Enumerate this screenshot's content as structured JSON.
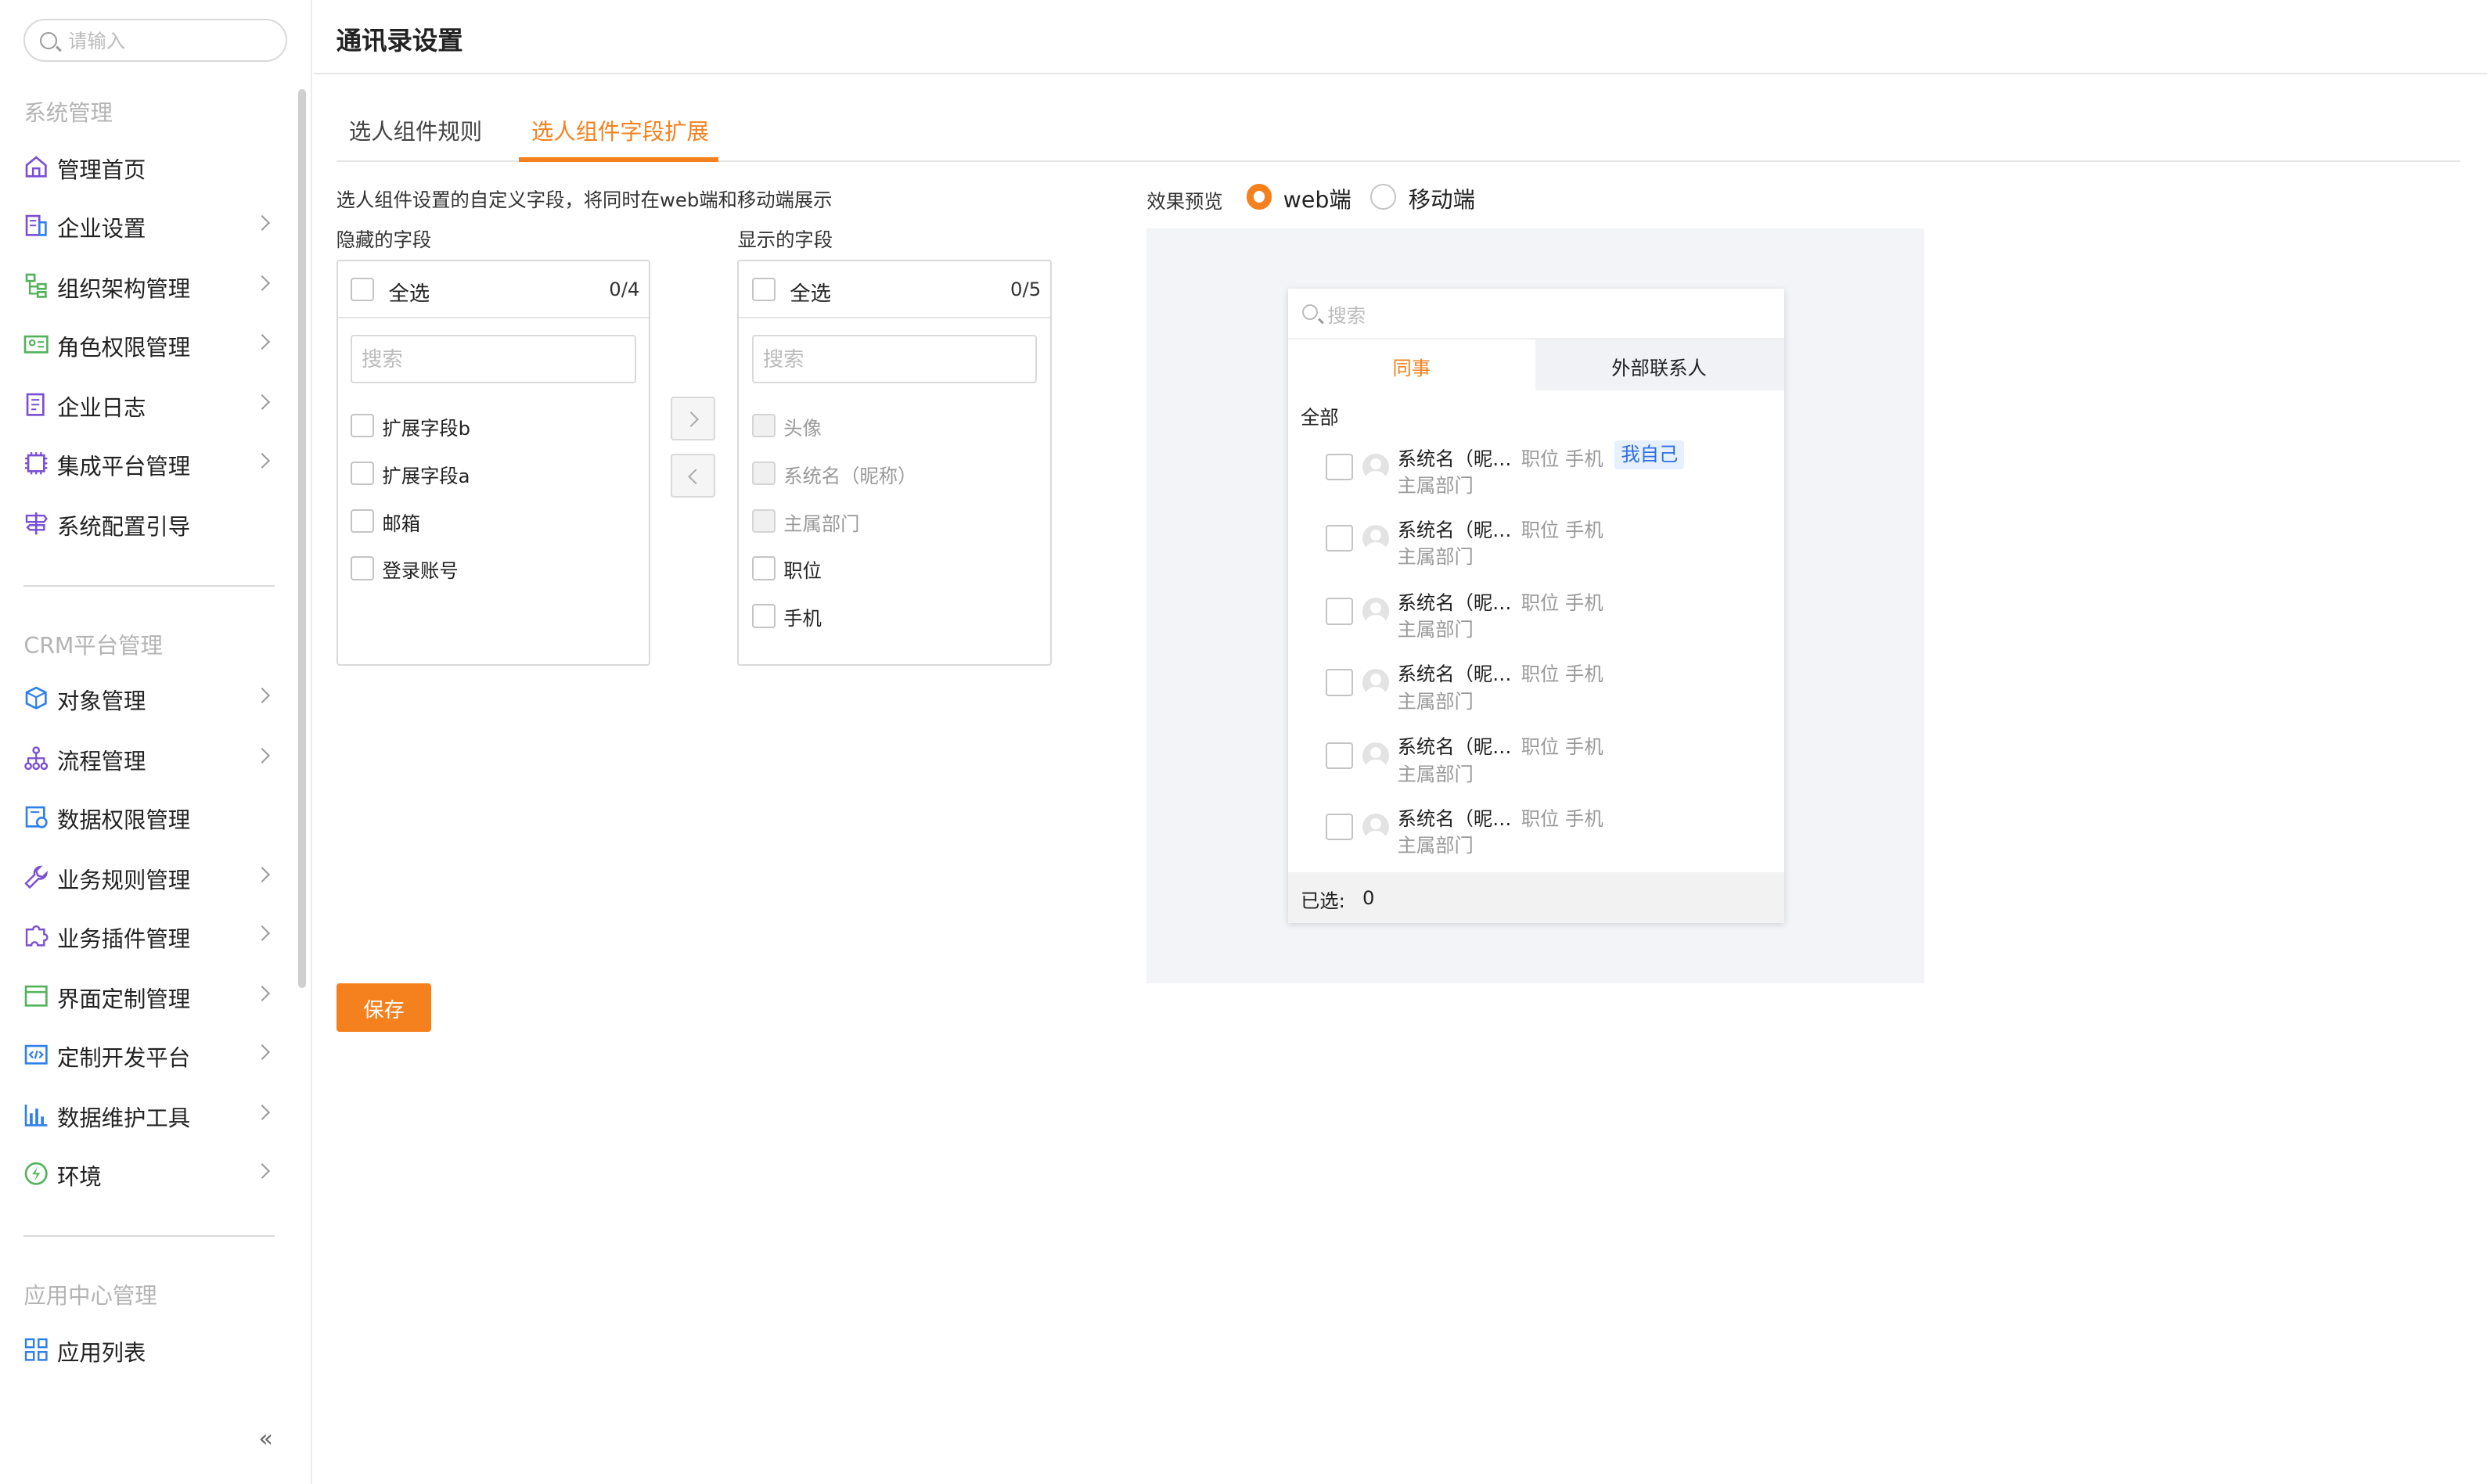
{
  "sidebar": {
    "search_placeholder": "请输入",
    "sections": [
      {
        "title": "系统管理",
        "items": [
          {
            "label": "管理首页",
            "icon": "home-icon",
            "chevron": false
          },
          {
            "label": "企业设置",
            "icon": "building-icon",
            "chevron": true
          },
          {
            "label": "组织架构管理",
            "icon": "org-tree-icon",
            "chevron": true
          },
          {
            "label": "角色权限管理",
            "icon": "id-card-icon",
            "chevron": true
          },
          {
            "label": "企业日志",
            "icon": "log-icon",
            "chevron": true
          },
          {
            "label": "集成平台管理",
            "icon": "chip-icon",
            "chevron": true
          },
          {
            "label": "系统配置引导",
            "icon": "signpost-icon",
            "chevron": false
          }
        ]
      },
      {
        "title": "CRM平台管理",
        "items": [
          {
            "label": "对象管理",
            "icon": "cube-icon",
            "chevron": true
          },
          {
            "label": "流程管理",
            "icon": "flow-icon",
            "chevron": true
          },
          {
            "label": "数据权限管理",
            "icon": "data-permission-icon",
            "chevron": false
          },
          {
            "label": "业务规则管理",
            "icon": "wrench-icon",
            "chevron": true
          },
          {
            "label": "业务插件管理",
            "icon": "puzzle-icon",
            "chevron": true
          },
          {
            "label": "界面定制管理",
            "icon": "window-icon",
            "chevron": true
          },
          {
            "label": "定制开发平台",
            "icon": "code-icon",
            "chevron": true
          },
          {
            "label": "数据维护工具",
            "icon": "bar-chart-icon",
            "chevron": true
          },
          {
            "label": "环境",
            "icon": "environment-icon",
            "chevron": true
          }
        ]
      },
      {
        "title": "应用中心管理",
        "items": [
          {
            "label": "应用列表",
            "icon": "grid-icon",
            "chevron": false
          }
        ]
      }
    ],
    "collapse_glyph": "«"
  },
  "header": {
    "title": "通讯录设置"
  },
  "tabs": [
    {
      "label": "选人组件规则",
      "active": false
    },
    {
      "label": "选人组件字段扩展",
      "active": true
    }
  ],
  "config": {
    "description": "选人组件设置的自定义字段，将同时在web端和移动端展示",
    "hidden_panel": {
      "title": "隐藏的字段",
      "select_all": "全选",
      "count": "0/4",
      "search_placeholder": "搜索",
      "items": [
        {
          "label": "扩展字段b",
          "disabled": false
        },
        {
          "label": "扩展字段a",
          "disabled": false
        },
        {
          "label": "邮箱",
          "disabled": false
        },
        {
          "label": "登录账号",
          "disabled": false
        }
      ]
    },
    "shown_panel": {
      "title": "显示的字段",
      "select_all": "全选",
      "count": "0/5",
      "search_placeholder": "搜索",
      "items": [
        {
          "label": "头像",
          "disabled": true
        },
        {
          "label": "系统名（昵称）",
          "disabled": true
        },
        {
          "label": "主属部门",
          "disabled": true
        },
        {
          "label": "职位",
          "disabled": false
        },
        {
          "label": "手机",
          "disabled": false
        }
      ]
    },
    "transfer": {
      "right": "›",
      "left": "‹"
    },
    "save_label": "保存"
  },
  "preview": {
    "label": "效果预览",
    "options": [
      {
        "label": "web端",
        "selected": true
      },
      {
        "label": "移动端",
        "selected": false
      }
    ],
    "card": {
      "search_placeholder": "搜索",
      "tabs": [
        {
          "label": "同事",
          "active": true
        },
        {
          "label": "外部联系人",
          "active": false
        }
      ],
      "group_label": "全部",
      "people": [
        {
          "name": "系统名（昵…",
          "meta": "职位 手机",
          "dept": "主属部门",
          "tag": "我自己"
        },
        {
          "name": "系统名（昵…",
          "meta": "职位 手机",
          "dept": "主属部门",
          "tag": ""
        },
        {
          "name": "系统名（昵…",
          "meta": "职位 手机",
          "dept": "主属部门",
          "tag": ""
        },
        {
          "name": "系统名（昵…",
          "meta": "职位 手机",
          "dept": "主属部门",
          "tag": ""
        },
        {
          "name": "系统名（昵…",
          "meta": "职位 手机",
          "dept": "主属部门",
          "tag": ""
        },
        {
          "name": "系统名（昵…",
          "meta": "职位 手机",
          "dept": "主属部门",
          "tag": ""
        }
      ],
      "selected_label": "已选:",
      "selected_count": "0"
    }
  },
  "colors": {
    "accent": "#f5811e",
    "icon_blue": "#2f7fe8",
    "icon_green": "#52b35a",
    "icon_purple": "#7a4fd6",
    "tag_bg": "#e6f0ff",
    "tag_text": "#2f6fe4",
    "preview_bg": "#f3f4f8"
  }
}
